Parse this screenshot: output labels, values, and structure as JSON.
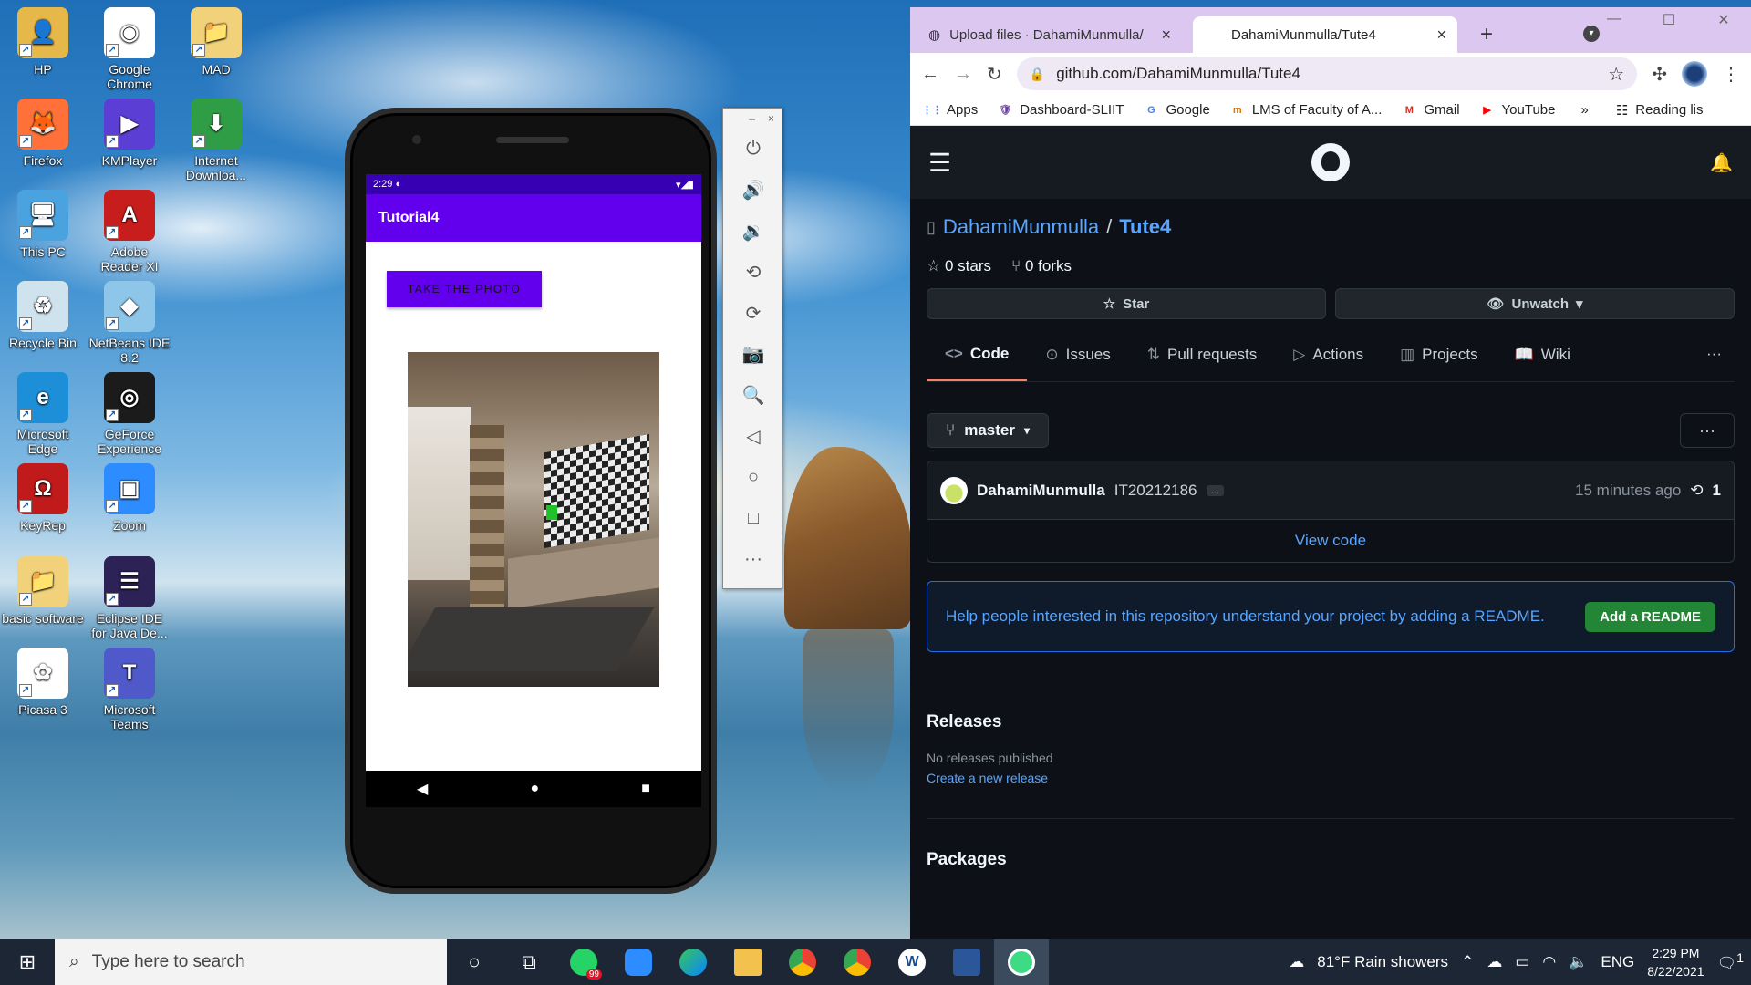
{
  "desktop": {
    "icons": [
      {
        "label": "HP",
        "color": "#e6b84a",
        "glyph": "👤"
      },
      {
        "label": "Google Chrome",
        "color": "#ffffff",
        "glyph": "◉"
      },
      {
        "label": "MAD",
        "color": "#f1d27a",
        "glyph": "📁"
      },
      {
        "label": "Firefox",
        "color": "#ff7139",
        "glyph": "🦊"
      },
      {
        "label": "KMPlayer",
        "color": "#5b3fd4",
        "glyph": "▶"
      },
      {
        "label": "Internet Downloa...",
        "color": "#2f9d45",
        "glyph": "⬇"
      },
      {
        "label": "This PC",
        "color": "#4aa3df",
        "glyph": "🖥"
      },
      {
        "label": "Adobe Reader XI",
        "color": "#c81d1d",
        "glyph": "A"
      },
      {
        "label": "Recycle Bin",
        "color": "#cfe3ef",
        "glyph": "♻"
      },
      {
        "label": "NetBeans IDE 8.2",
        "color": "#8ec6ea",
        "glyph": "◆"
      },
      {
        "label": "Microsoft Edge",
        "color": "#1c8fd8",
        "glyph": "e"
      },
      {
        "label": "GeForce Experience",
        "color": "#1b1b1b",
        "glyph": "◎"
      },
      {
        "label": "KeyRep",
        "color": "#c01a1a",
        "glyph": "Ω"
      },
      {
        "label": "Zoom",
        "color": "#2d8cff",
        "glyph": "▣"
      },
      {
        "label": "basic software",
        "color": "#f1d27a",
        "glyph": "📁"
      },
      {
        "label": "Eclipse IDE for Java De...",
        "color": "#2c2255",
        "glyph": "☰"
      },
      {
        "label": "Picasa 3",
        "color": "#ffffff",
        "glyph": "✿"
      },
      {
        "label": "Microsoft Teams",
        "color": "#5059c9",
        "glyph": "T"
      }
    ]
  },
  "emulator": {
    "status_time": "2:29",
    "app_title": "Tutorial4",
    "take_photo_label": "TAKE THE PHOTO",
    "nav": {
      "back": "◀",
      "home": "●",
      "recents": "■"
    },
    "toolbar": {
      "minimize": "–",
      "close": "×",
      "buttons": [
        {
          "name": "power-icon",
          "glyph": "⏻"
        },
        {
          "name": "volume-up-icon",
          "glyph": "🔊"
        },
        {
          "name": "volume-down-icon",
          "glyph": "🔉"
        },
        {
          "name": "rotate-left-icon",
          "glyph": "⟲"
        },
        {
          "name": "rotate-right-icon",
          "glyph": "⟳"
        },
        {
          "name": "camera-icon",
          "glyph": "📷"
        },
        {
          "name": "zoom-icon",
          "glyph": "🔍"
        },
        {
          "name": "back-icon",
          "glyph": "◁"
        },
        {
          "name": "home-icon",
          "glyph": "○"
        },
        {
          "name": "overview-icon",
          "glyph": "□"
        },
        {
          "name": "more-icon",
          "glyph": "···"
        }
      ]
    }
  },
  "browser": {
    "tabs": [
      {
        "title": "Upload files · DahamiMunmulla/",
        "close": "×"
      },
      {
        "title": "DahamiMunmulla/Tute4",
        "close": "×"
      }
    ],
    "new_tab": "+",
    "url": "github.com/DahamiMunmulla/Tute4",
    "bookmarks": [
      {
        "label": "Apps",
        "icon": "⋮⋮",
        "color": "#4285f4"
      },
      {
        "label": "Dashboard-SLIIT",
        "icon": "🛡",
        "color": "#6a3fa0"
      },
      {
        "label": "Google",
        "icon": "G",
        "color": "#4285f4"
      },
      {
        "label": "LMS of Faculty of A...",
        "icon": "m",
        "color": "#e37400"
      },
      {
        "label": "Gmail",
        "icon": "M",
        "color": "#d93025"
      },
      {
        "label": "YouTube",
        "icon": "▶",
        "color": "#ff0000"
      }
    ],
    "bookmarks_more": "»",
    "reading_list": "Reading lis"
  },
  "github": {
    "owner": "DahamiMunmulla",
    "separator": "/",
    "repo": "Tute4",
    "stars": "0 stars",
    "forks": "0 forks",
    "star_button": "Star",
    "watch_button": "Unwatch",
    "nav": [
      {
        "label": "Code",
        "icon": "<>"
      },
      {
        "label": "Issues",
        "icon": "⊙"
      },
      {
        "label": "Pull requests",
        "icon": "⇅"
      },
      {
        "label": "Actions",
        "icon": "▷"
      },
      {
        "label": "Projects",
        "icon": "▥"
      },
      {
        "label": "Wiki",
        "icon": "📖"
      }
    ],
    "branch": "master",
    "commit": {
      "author": "DahamiMunmulla",
      "message": "IT20212186",
      "ellipsis": "...",
      "time": "15 minutes ago",
      "count": "1"
    },
    "view_code": "View code",
    "readme_prompt": "Help people interested in this repository understand your project by adding a README.",
    "readme_button": "Add a README",
    "releases_heading": "Releases",
    "no_releases": "No releases published",
    "create_release": "Create a new release",
    "packages_heading": "Packages"
  },
  "taskbar": {
    "search_placeholder": "Type here to search",
    "whatsapp_badge": "99",
    "weather": "81°F  Rain showers",
    "language": "ENG",
    "time": "2:29 PM",
    "date": "8/22/2021",
    "notifications": "1"
  }
}
